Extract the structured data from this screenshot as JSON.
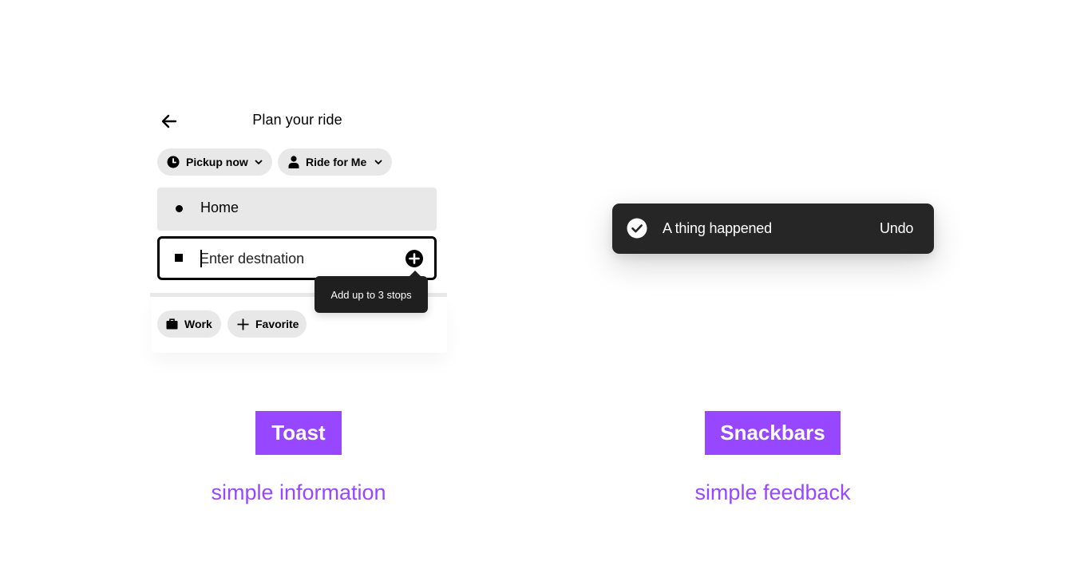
{
  "colors": {
    "accent": "#9747ff",
    "chip_bg": "#e8e8e8",
    "snackbar_bg": "#262626",
    "tooltip_bg": "#1f1f1f"
  },
  "toast_example": {
    "title": "Plan your ride",
    "back_icon": "arrow-left-icon",
    "chips": {
      "pickup": {
        "label": "Pickup now",
        "icon": "clock-icon"
      },
      "ride_for": {
        "label": "Ride for Me",
        "icon": "person-icon"
      }
    },
    "origin_field": {
      "value": "Home"
    },
    "destination_field": {
      "placeholder": "Enter destnation",
      "value": ""
    },
    "add_stop_icon": "plus-circle-icon",
    "tooltip": "Add up to 3 stops",
    "shortcuts": [
      {
        "label": "Work",
        "icon": "briefcase-icon"
      },
      {
        "label": "Favorite",
        "icon": "plus-icon"
      }
    ]
  },
  "snackbar_example": {
    "icon": "check-circle-icon",
    "message": "A thing happened",
    "action": "Undo"
  },
  "labels": {
    "toast": {
      "tag": "Toast",
      "caption": "simple information"
    },
    "snackbar": {
      "tag": "Snackbars",
      "caption": "simple feedback"
    }
  }
}
